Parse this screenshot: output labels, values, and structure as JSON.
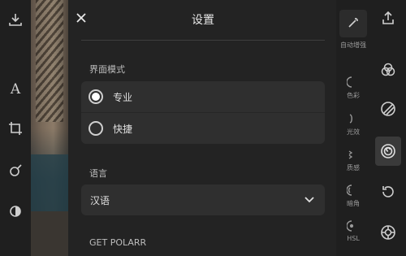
{
  "dialog": {
    "title": "设置",
    "display_mode_label": "界面模式",
    "display_modes": [
      {
        "label": "专业",
        "selected": true
      },
      {
        "label": "快捷",
        "selected": false
      }
    ],
    "language_label": "语言",
    "language_value": "汉语",
    "get_polarr_label": "GET POLARR"
  },
  "tools": {
    "auto_enhance_label": "自动增强",
    "items": [
      {
        "label": "色彩",
        "icon": "color-icon"
      },
      {
        "label": "光效",
        "icon": "light-icon"
      },
      {
        "label": "质感",
        "icon": "texture-icon"
      },
      {
        "label": "暗角",
        "icon": "vignette-icon"
      },
      {
        "label": "HSL",
        "icon": "hsl-icon"
      }
    ]
  },
  "left_toolbar": [
    "download-icon",
    "text-icon",
    "crop-icon",
    "brush-icon",
    "mask-icon"
  ],
  "right_toolbar": [
    "share-icon",
    "filters-icon",
    "adjust-icon",
    "local-adjust-icon",
    "history-icon",
    "settings-icon"
  ],
  "colors": {
    "background": "#1c1c1c",
    "card": "#2f2f2f",
    "text": "#e0e0e0"
  }
}
